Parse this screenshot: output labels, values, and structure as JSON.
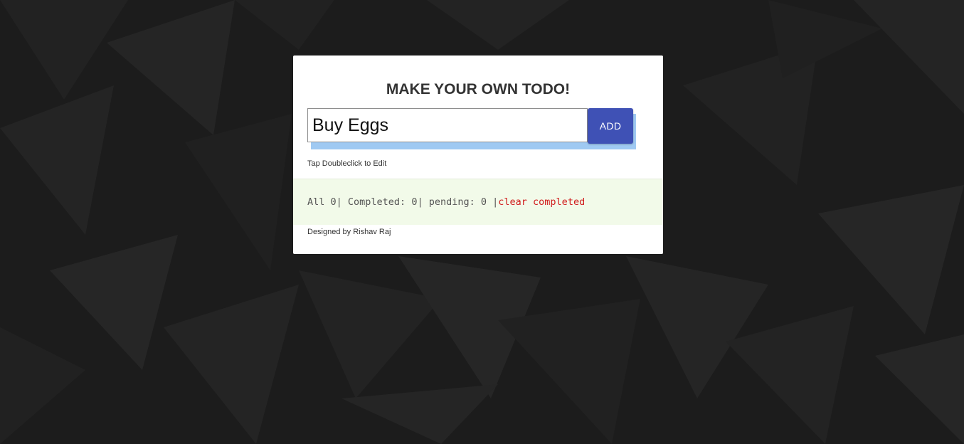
{
  "app": {
    "title": "MAKE YOUR OWN TODO!"
  },
  "input": {
    "value": "Buy Eggs"
  },
  "add_button": {
    "label": "ADD"
  },
  "hint": "Tap Doubleclick to Edit",
  "status": {
    "all_label": "All ",
    "all_count": "0",
    "completed_label": "| Completed: ",
    "completed_count": "0",
    "pending_label": "| pending: ",
    "pending_count": "0",
    "separator": " |",
    "clear_label": "clear completed"
  },
  "footer": "Designed by Rishav Raj",
  "colors": {
    "background": "#1c1c1c",
    "accent": "#3f51b5",
    "input_shadow": "#9fc9f2",
    "status_bg": "#f2fae9",
    "clear_link": "#d01b1b"
  }
}
